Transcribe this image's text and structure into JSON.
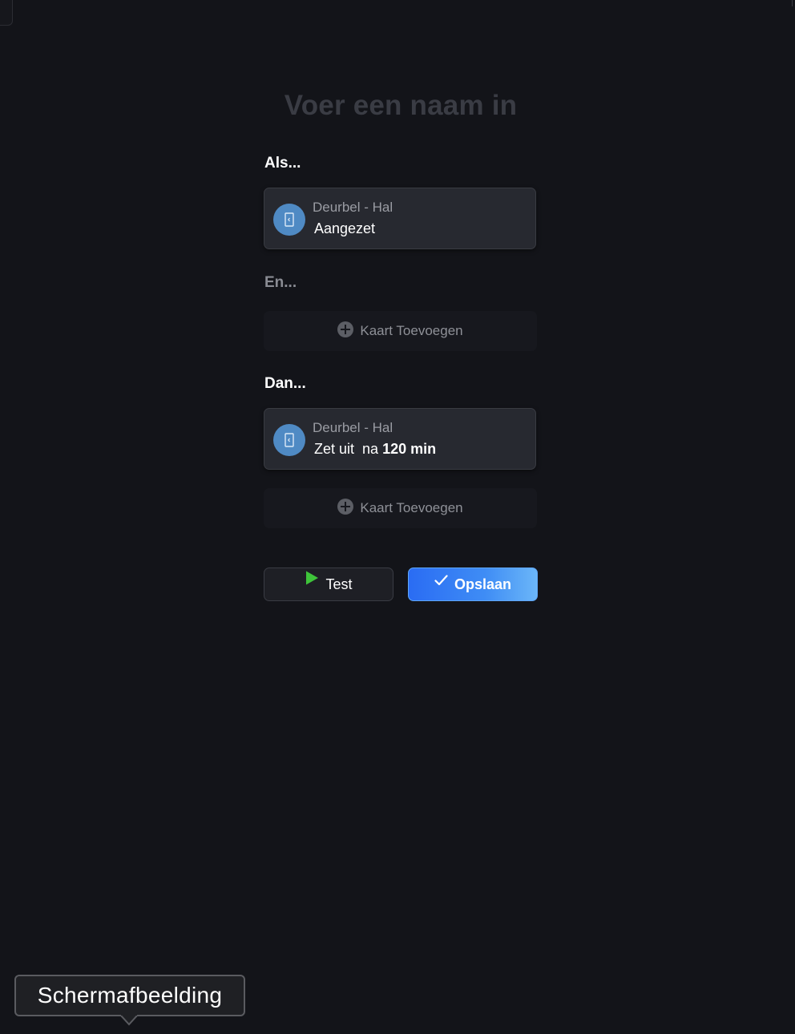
{
  "flow": {
    "name_placeholder": "Voer een naam in"
  },
  "sections": {
    "when_label": "Als...",
    "and_label": "En...",
    "then_label": "Dan..."
  },
  "trigger_card": {
    "device": "Deurbel - Hal",
    "action": "Aangezet",
    "icon": "door-icon",
    "icon_color": "#4f8ac4"
  },
  "action_card": {
    "device": "Deurbel - Hal",
    "action": "Zet uit",
    "delay_prefix": "na",
    "delay_value": "120 min",
    "icon": "door-icon",
    "icon_color": "#4f8ac4"
  },
  "add_card_label": "Kaart Toevoegen",
  "buttons": {
    "test_label": "Test",
    "save_label": "Opslaan"
  },
  "colors": {
    "background": "#131419",
    "accent_blue": "#2a6cf3",
    "play_green": "#3ec43a"
  },
  "tooltip": {
    "text": "Schermafbeelding"
  }
}
